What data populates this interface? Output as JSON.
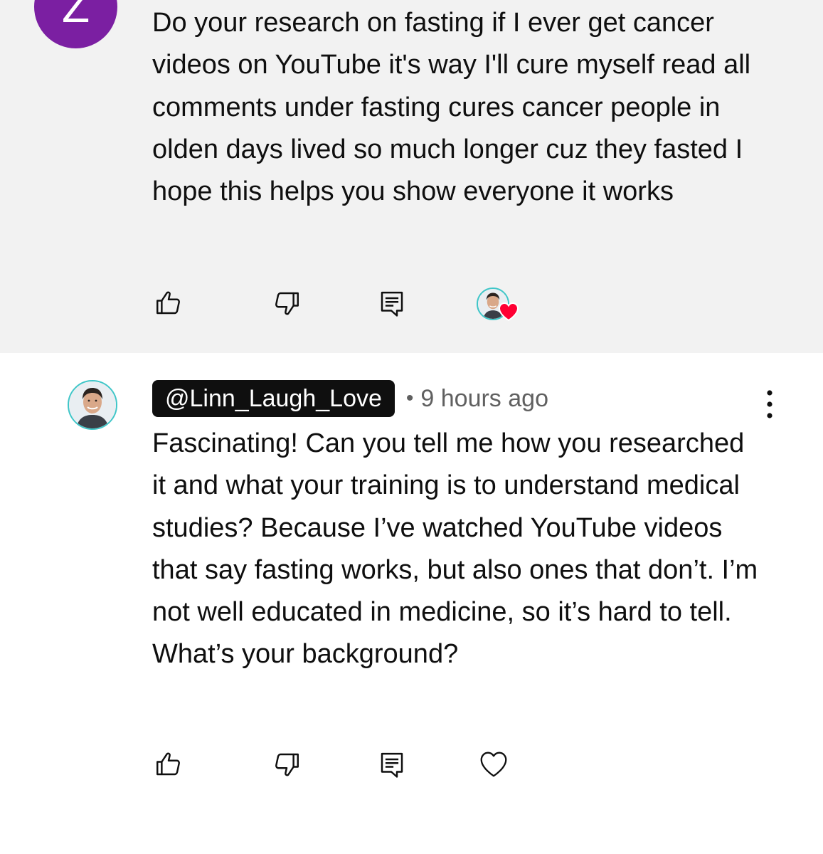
{
  "comments": [
    {
      "avatar_letter": "Z",
      "text": "Do your research on fasting if I ever get cancer videos on YouTube it's way I'll cure myself read all comments under fasting cures cancer people in olden days lived so much longer cuz they fasted I hope this helps you show everyone it works",
      "hearted_by_creator": true
    },
    {
      "handle": "@Linn_Laugh_Love",
      "separator": "•",
      "time": "9 hours ago",
      "text": "Fascinating! Can you tell me how you researched it and what your training is to understand medical studies? Because I’ve watched YouTube videos that say fasting works, but also ones that don’t. I’m not well educated in medicine, so it’s hard to tell. What’s your background?"
    }
  ],
  "icons": {
    "like": "thumbs-up-icon",
    "dislike": "thumbs-down-icon",
    "reply": "reply-icon",
    "heart": "heart-icon",
    "more": "more-vert-icon"
  },
  "colors": {
    "highlight_bg": "#f2f2f2",
    "avatar_purple": "#7b1fa2",
    "heart_red": "#ff0033",
    "secondary_text": "#606060"
  }
}
